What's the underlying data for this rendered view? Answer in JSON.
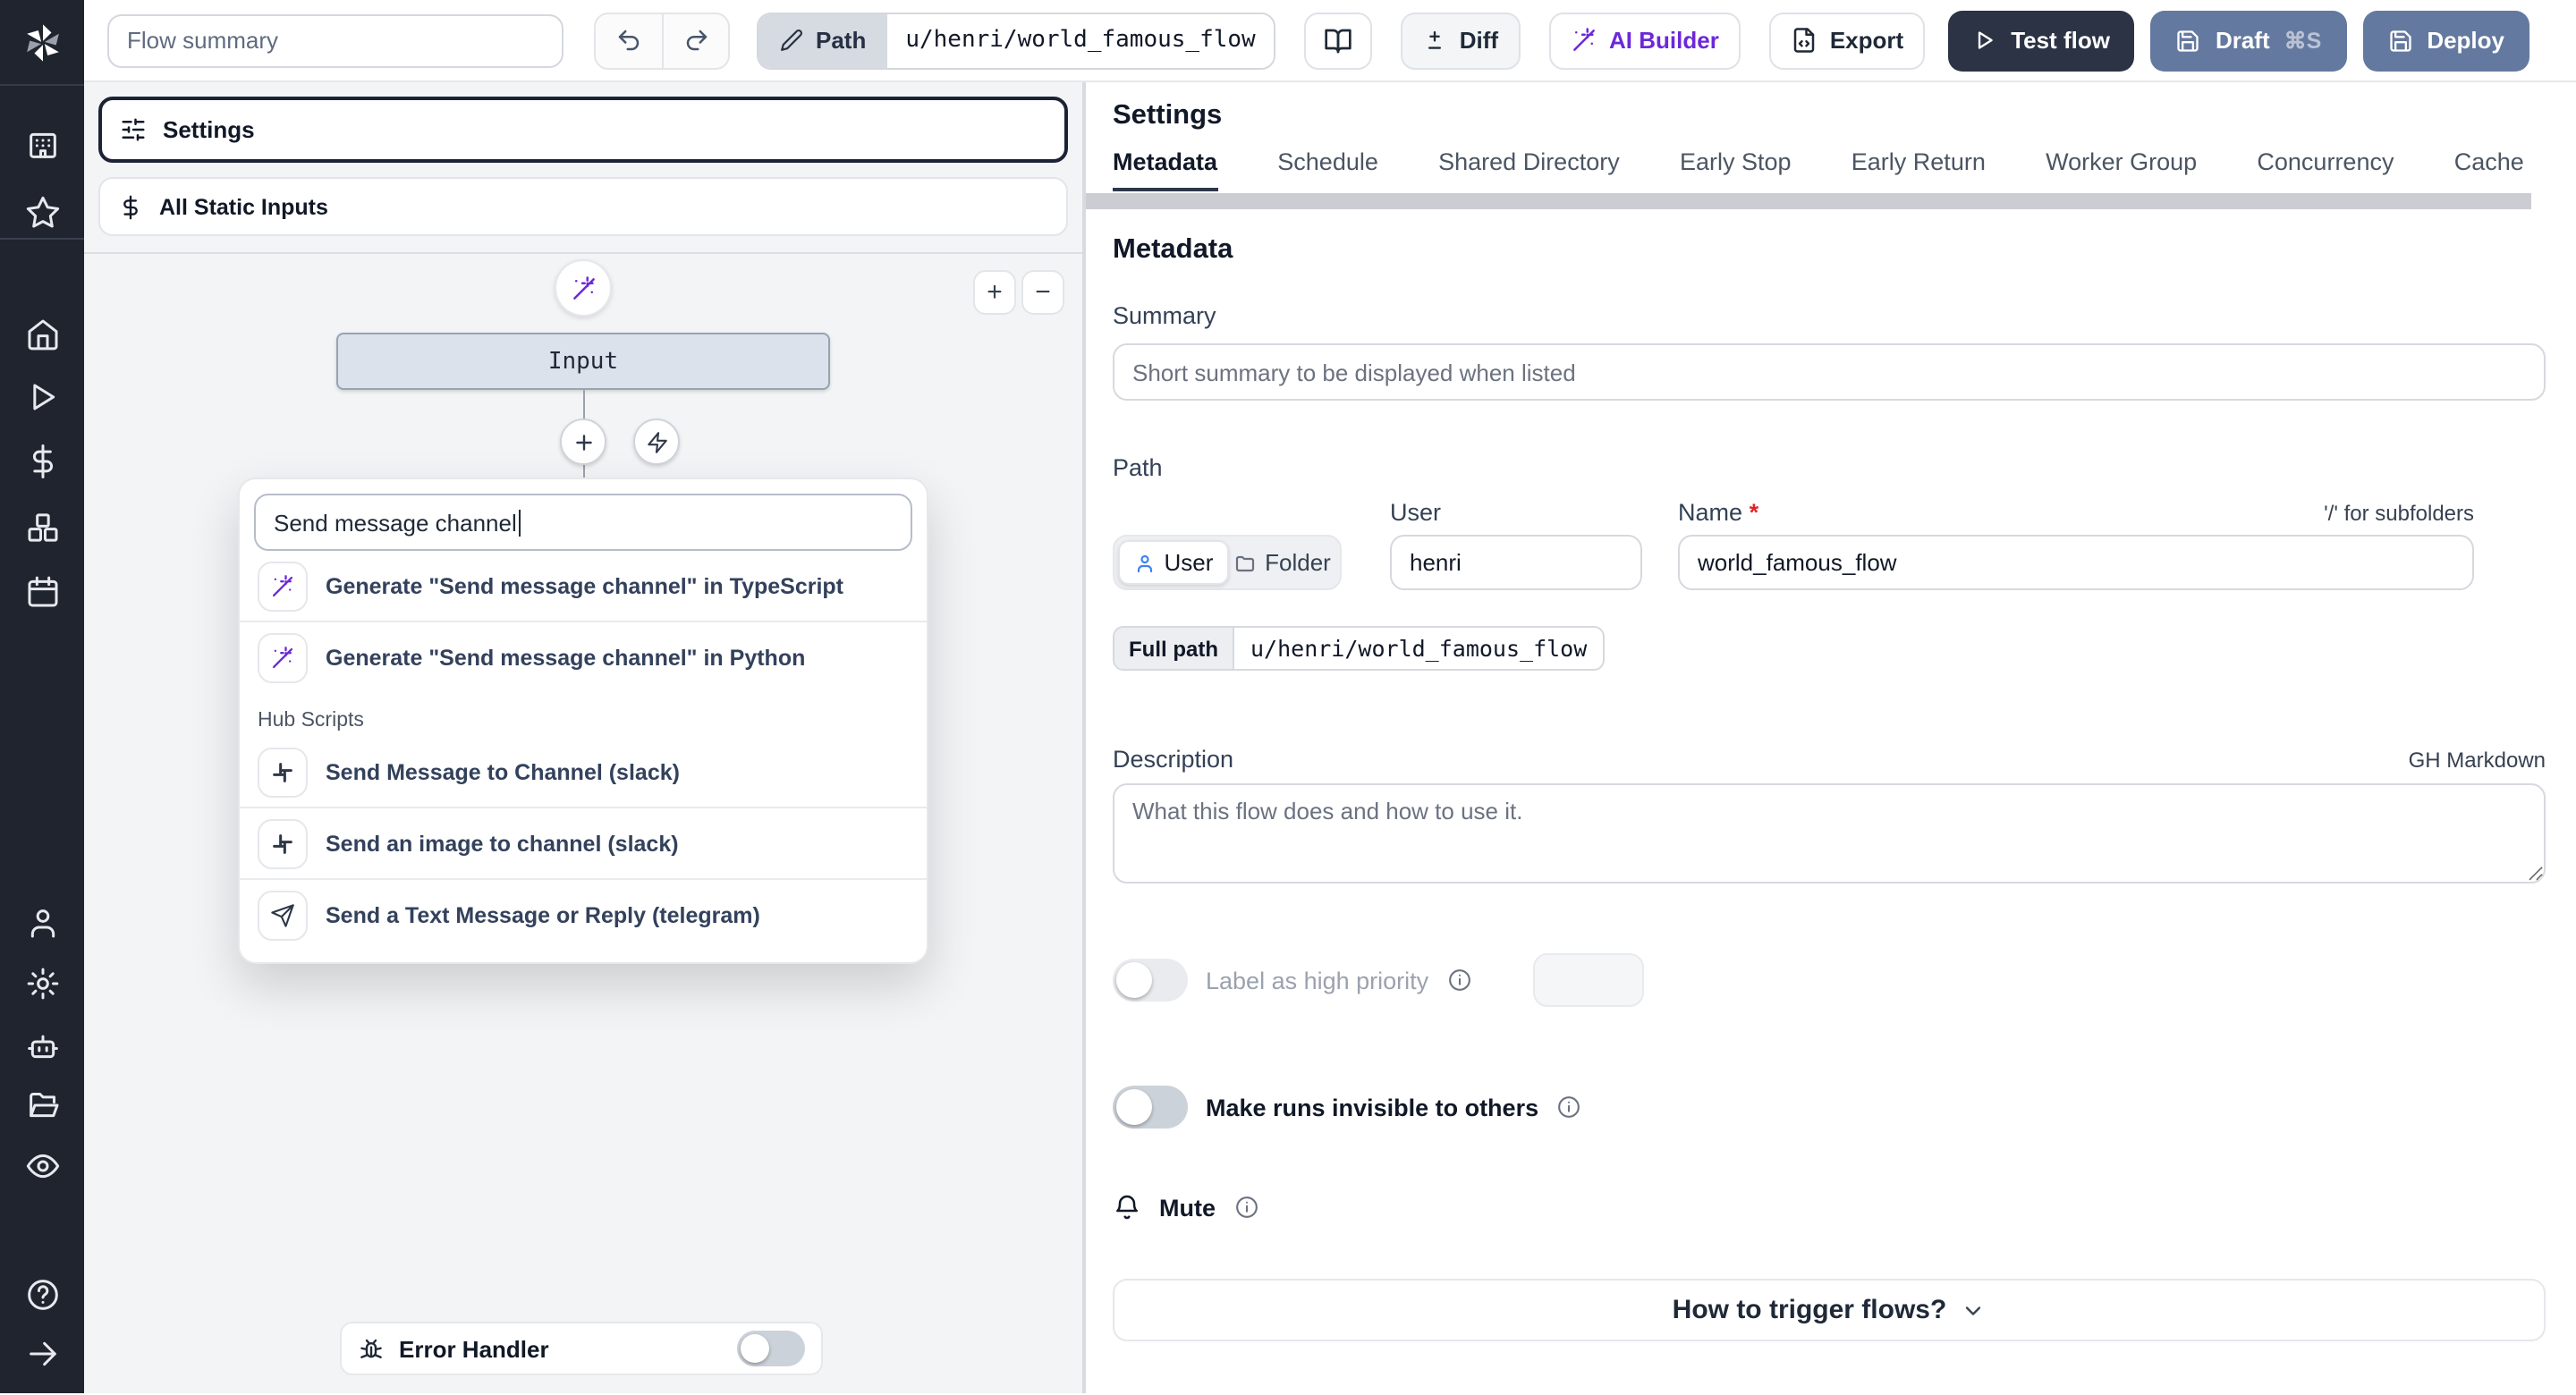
{
  "topbar": {
    "flow_summary_placeholder": "Flow summary",
    "path_label": "Path",
    "path_value": "u/henri/world_famous_flow",
    "diff_label": "Diff",
    "ai_builder_label": "AI Builder",
    "export_label": "Export",
    "test_flow_label": "Test flow",
    "draft_label": "Draft",
    "draft_shortcut": "⌘S",
    "deploy_label": "Deploy"
  },
  "sidebar": {
    "icons": [
      "windmill-logo",
      "building",
      "star",
      "home",
      "play",
      "dollar",
      "boxes",
      "calendar",
      "user",
      "gear",
      "bot",
      "folder-open",
      "eye",
      "help",
      "arrow-right"
    ]
  },
  "left_panel": {
    "settings_label": "Settings",
    "static_inputs_label": "All Static Inputs",
    "zoom_in": "+",
    "zoom_out": "−",
    "input_node_label": "Input",
    "search_value": "Send message channel",
    "dropdown": {
      "items": [
        {
          "icon": "wand",
          "label": "Generate \"Send message channel\" in TypeScript"
        },
        {
          "icon": "wand",
          "label": "Generate \"Send message channel\" in Python"
        }
      ],
      "section_label": "Hub Scripts",
      "hub_items": [
        {
          "icon": "slack",
          "label": "Send Message to Channel (slack)"
        },
        {
          "icon": "slack",
          "label": "Send an image to channel (slack)"
        },
        {
          "icon": "telegram",
          "label": "Send a Text Message or Reply (telegram)"
        }
      ]
    },
    "error_handler_label": "Error Handler"
  },
  "right_panel": {
    "title": "Settings",
    "tabs": [
      "Metadata",
      "Schedule",
      "Shared Directory",
      "Early Stop",
      "Early Return",
      "Worker Group",
      "Concurrency",
      "Cache"
    ],
    "active_tab": "Metadata",
    "metadata": {
      "heading": "Metadata",
      "summary_label": "Summary",
      "summary_placeholder": "Short summary to be displayed when listed",
      "path_label": "Path",
      "user_toggle": "User",
      "folder_toggle": "Folder",
      "user_label": "User",
      "user_value": "henri",
      "name_label": "Name",
      "name_required": "*",
      "subfolder_hint": "'/' for subfolders",
      "name_value": "world_famous_flow",
      "full_path_label": "Full path",
      "full_path_value": "u/henri/world_famous_flow",
      "description_label": "Description",
      "markdown_hint": "GH Markdown",
      "description_placeholder": "What this flow does and how to use it.",
      "priority_label": "Label as high priority",
      "invisible_label": "Make runs invisible to others",
      "mute_label": "Mute",
      "trigger_label": "How to trigger flows?"
    }
  },
  "colors": {
    "sidebar_bg": "#20242e",
    "primary_dark": "#2b3344",
    "deploy_slate": "#64799f",
    "ai_purple": "#6d28d9",
    "node_fill": "#dbe2ec"
  }
}
